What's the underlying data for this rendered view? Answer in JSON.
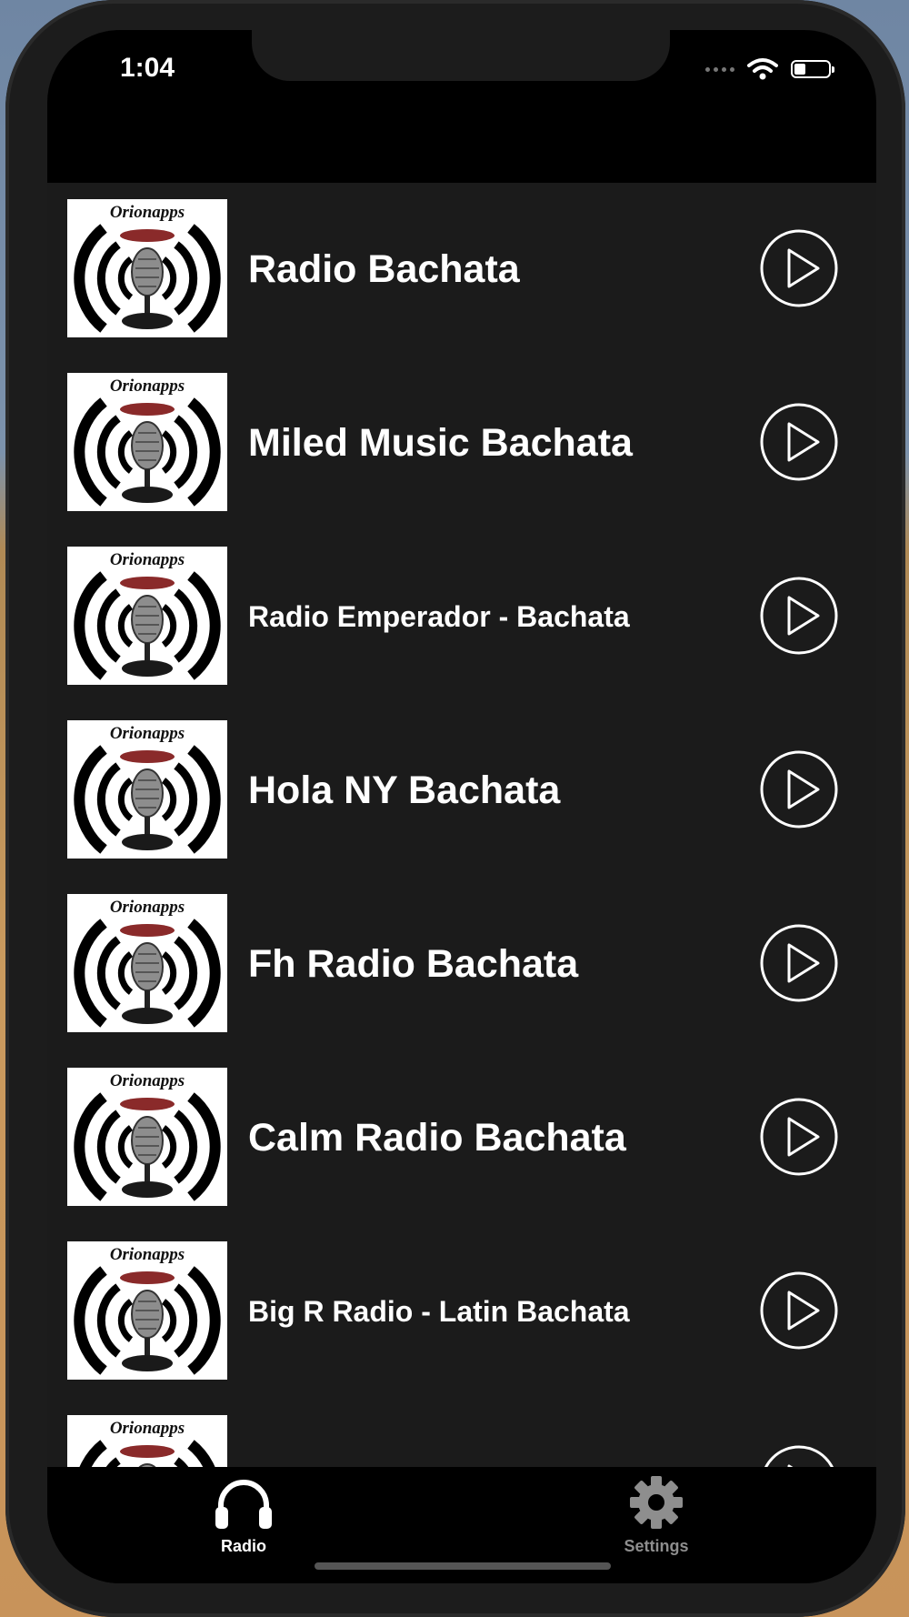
{
  "status": {
    "time": "1:04"
  },
  "stations": [
    {
      "brand": "Orionapps",
      "name": "Radio Bachata",
      "size": "big"
    },
    {
      "brand": "Orionapps",
      "name": "Miled Music Bachata",
      "size": "big"
    },
    {
      "brand": "Orionapps",
      "name": "Radio Emperador - Bachata",
      "size": "small"
    },
    {
      "brand": "Orionapps",
      "name": "Hola NY Bachata",
      "size": "big"
    },
    {
      "brand": "Orionapps",
      "name": "Fh Radio Bachata",
      "size": "big"
    },
    {
      "brand": "Orionapps",
      "name": "Calm Radio Bachata",
      "size": "big"
    },
    {
      "brand": "Orionapps",
      "name": "Big R Radio - Latin Bachata",
      "size": "small"
    },
    {
      "brand": "Orionapps",
      "name": "",
      "size": "big"
    }
  ],
  "tabs": [
    {
      "label": "Radio",
      "icon": "headphones-icon",
      "active": true
    },
    {
      "label": "Settings",
      "icon": "gear-icon",
      "active": false
    }
  ],
  "colors": {
    "background": "#1b1b1b",
    "active_tab": "#ffffff",
    "inactive_tab": "#8e8e8e"
  }
}
